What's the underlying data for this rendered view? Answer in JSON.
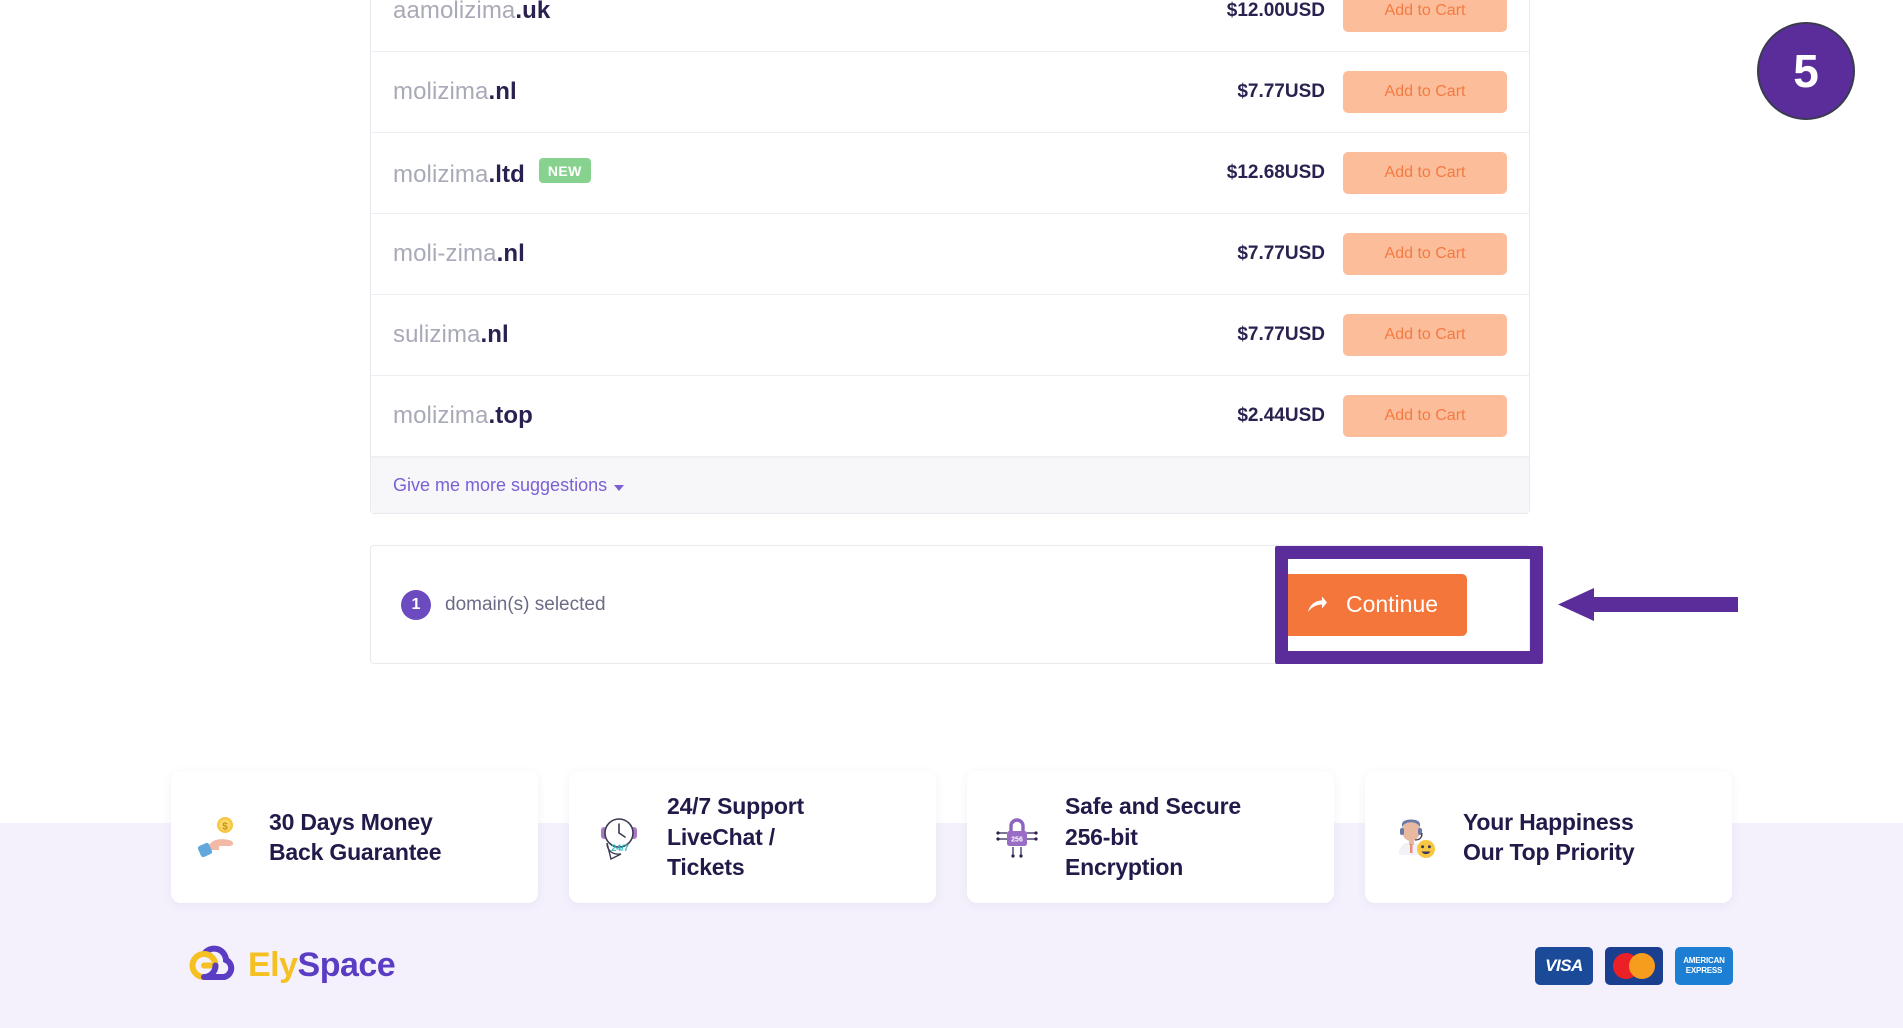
{
  "step_badge": {
    "number": "5"
  },
  "domain_list": {
    "rows": [
      {
        "sld": "aamolizima",
        "tld": ".uk",
        "price": "$12.00USD",
        "badge": null,
        "cta": "Add to Cart"
      },
      {
        "sld": "molizima",
        "tld": ".nl",
        "price": "$7.77USD",
        "badge": null,
        "cta": "Add to Cart"
      },
      {
        "sld": "molizima",
        "tld": ".ltd",
        "price": "$12.68USD",
        "badge": "NEW",
        "cta": "Add to Cart"
      },
      {
        "sld": "moli-zima",
        "tld": ".nl",
        "price": "$7.77USD",
        "badge": null,
        "cta": "Add to Cart"
      },
      {
        "sld": "sulizima",
        "tld": ".nl",
        "price": "$7.77USD",
        "badge": null,
        "cta": "Add to Cart"
      },
      {
        "sld": "molizima",
        "tld": ".top",
        "price": "$2.44USD",
        "badge": null,
        "cta": "Add to Cart"
      }
    ],
    "more_suggestions_label": "Give me more suggestions"
  },
  "selection_bar": {
    "count": "1",
    "selected_label": "domain(s) selected",
    "continue_label": "Continue"
  },
  "features": [
    {
      "icon": "money-hand-icon",
      "line1": "30 Days Money",
      "line2": "Back Guarantee",
      "line3": ""
    },
    {
      "icon": "clock-support-icon",
      "line1": "24/7 Support",
      "line2": "LiveChat /",
      "line3": "Tickets"
    },
    {
      "icon": "lock-chip-icon",
      "line1": "Safe and Secure",
      "line2": "256-bit",
      "line3": "Encryption"
    },
    {
      "icon": "agent-smile-icon",
      "line1": "Your Happiness",
      "line2": "Our Top Priority",
      "line3": ""
    }
  ],
  "footer": {
    "logo_part1": "Ely",
    "logo_part2": "Space",
    "payments": [
      {
        "name": "visa",
        "label": "VISA"
      },
      {
        "name": "mastercard",
        "label": ""
      },
      {
        "name": "amex",
        "label1": "AMERICAN",
        "label2": "EXPRESS"
      }
    ]
  },
  "colors": {
    "accent_orange": "#f4763a",
    "accent_purple": "#5b2d9b",
    "badge_green": "#86d28e",
    "cart_btn_bg": "#fbbd9a",
    "cart_btn_text": "#f47a42",
    "text_dark": "#2b2150"
  }
}
